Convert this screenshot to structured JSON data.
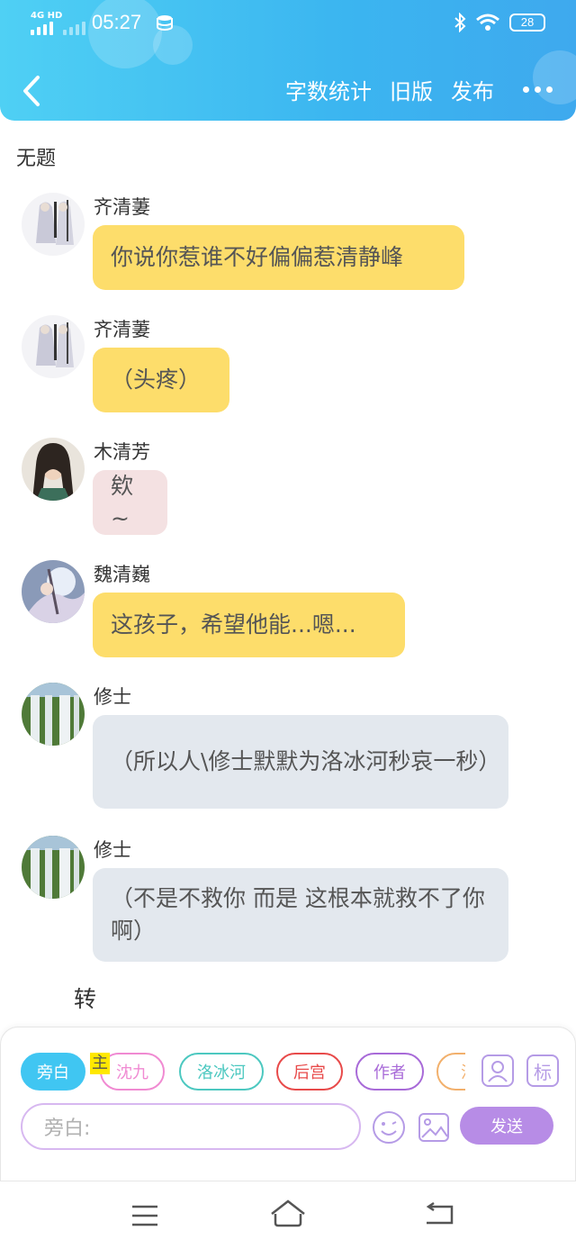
{
  "status_bar": {
    "network": "4G HD",
    "time": "05:27",
    "battery": "28"
  },
  "header": {
    "actions": [
      "字数统计",
      "旧版",
      "发布"
    ]
  },
  "document": {
    "title": "无题"
  },
  "messages": [
    {
      "sender": "齐清萋",
      "text": "你说你惹谁不好偏偏惹清静峰",
      "style": "yellow"
    },
    {
      "sender": "齐清萋",
      "text": "（头疼）",
      "style": "yellow"
    },
    {
      "sender": "木清芳",
      "text": "欸~",
      "style": "pink"
    },
    {
      "sender": "魏清巍",
      "text": "这孩子，希望他能...嗯...",
      "style": "yellow"
    },
    {
      "sender": "修士",
      "text": "（所以人\\修士默默为洛冰河秒哀一秒）",
      "style": "gray"
    },
    {
      "sender": "修士",
      "text": "（不是不救你 而是 这根本就救不了你啊）",
      "style": "gray"
    }
  ],
  "loose_text": "转",
  "composer": {
    "chips": [
      "旁白",
      "沈九",
      "洛冰河",
      "后宫",
      "作者",
      "沈"
    ],
    "highlight_char": "主",
    "right_tag": "标",
    "input_placeholder": "旁白:",
    "send_label": "发送"
  },
  "colors": {
    "header_gradient": [
      "#4fd0f4",
      "#3ea9ee"
    ],
    "bubble_yellow": "#fddd6b",
    "bubble_pink": "#f4e1e2",
    "bubble_gray": "#e3e8ee",
    "send_button": "#b78ce6"
  }
}
